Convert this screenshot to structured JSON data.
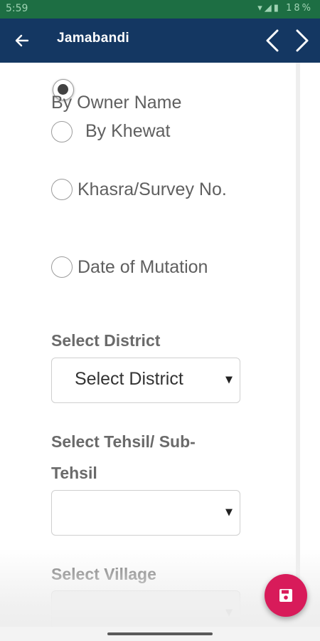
{
  "status_bar": {
    "time": "5:59",
    "battery_text": "18%",
    "icons": [
      "data-speed-icon",
      "alarm-icon",
      "headphones-icon",
      "volte-icon",
      "mute-icon",
      "wifi-icon",
      "signal-icon",
      "signal-icon",
      "battery-icon"
    ]
  },
  "app_bar": {
    "title": "Jamabandi",
    "background": "#143762"
  },
  "search_options": [
    {
      "label": "By Owner Name",
      "checked": true
    },
    {
      "label": "By Khewat",
      "checked": false
    },
    {
      "label": "Khasra/Survey No.",
      "checked": false
    },
    {
      "label": "Date of Mutation",
      "checked": false
    }
  ],
  "district": {
    "label": "Select District",
    "value": "Select District"
  },
  "tehsil": {
    "label_line1": "Select Tehsil/ Sub-",
    "label_line2": "Tehsil",
    "value": ""
  },
  "village": {
    "label": "Select Village",
    "value": ""
  },
  "fab": {
    "icon": "save-icon",
    "color": "#d81b5a"
  }
}
